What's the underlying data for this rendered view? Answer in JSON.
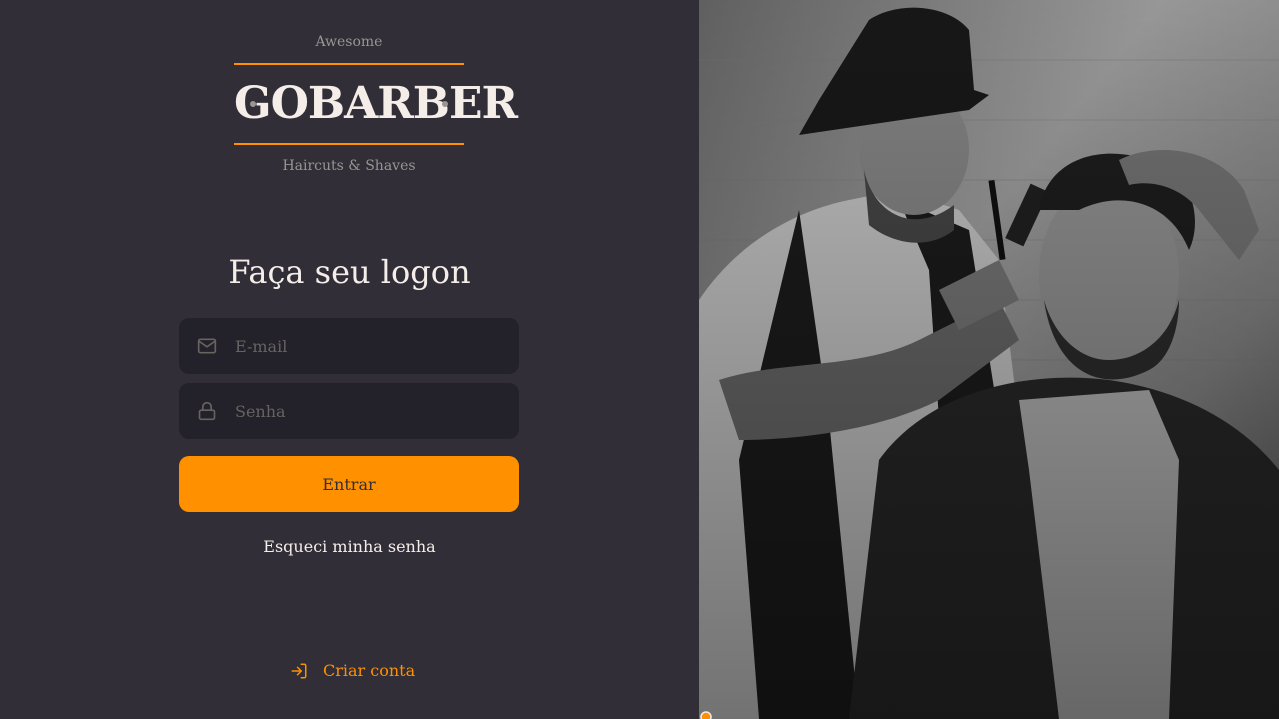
{
  "logo": {
    "top_text": "Awesome",
    "brand": "GOBARBER",
    "bottom_text": "Haircuts & Shaves",
    "accent_color": "#ff9000"
  },
  "title": "Faça seu logon",
  "form": {
    "email": {
      "placeholder": "E-mail",
      "value": "",
      "icon": "mail-icon"
    },
    "password": {
      "placeholder": "Senha",
      "value": "",
      "icon": "lock-icon"
    },
    "submit_label": "Entrar",
    "forgot_label": "Esqueci minha senha"
  },
  "create_account": {
    "label": "Criar conta",
    "icon": "log-in-icon"
  },
  "colors": {
    "background": "#312e38",
    "input_background": "#232129",
    "button": "#ff9000",
    "text": "#f4ede8",
    "muted": "#999591",
    "placeholder": "#666360"
  },
  "background_image": {
    "description_icon": "barber-photo"
  }
}
